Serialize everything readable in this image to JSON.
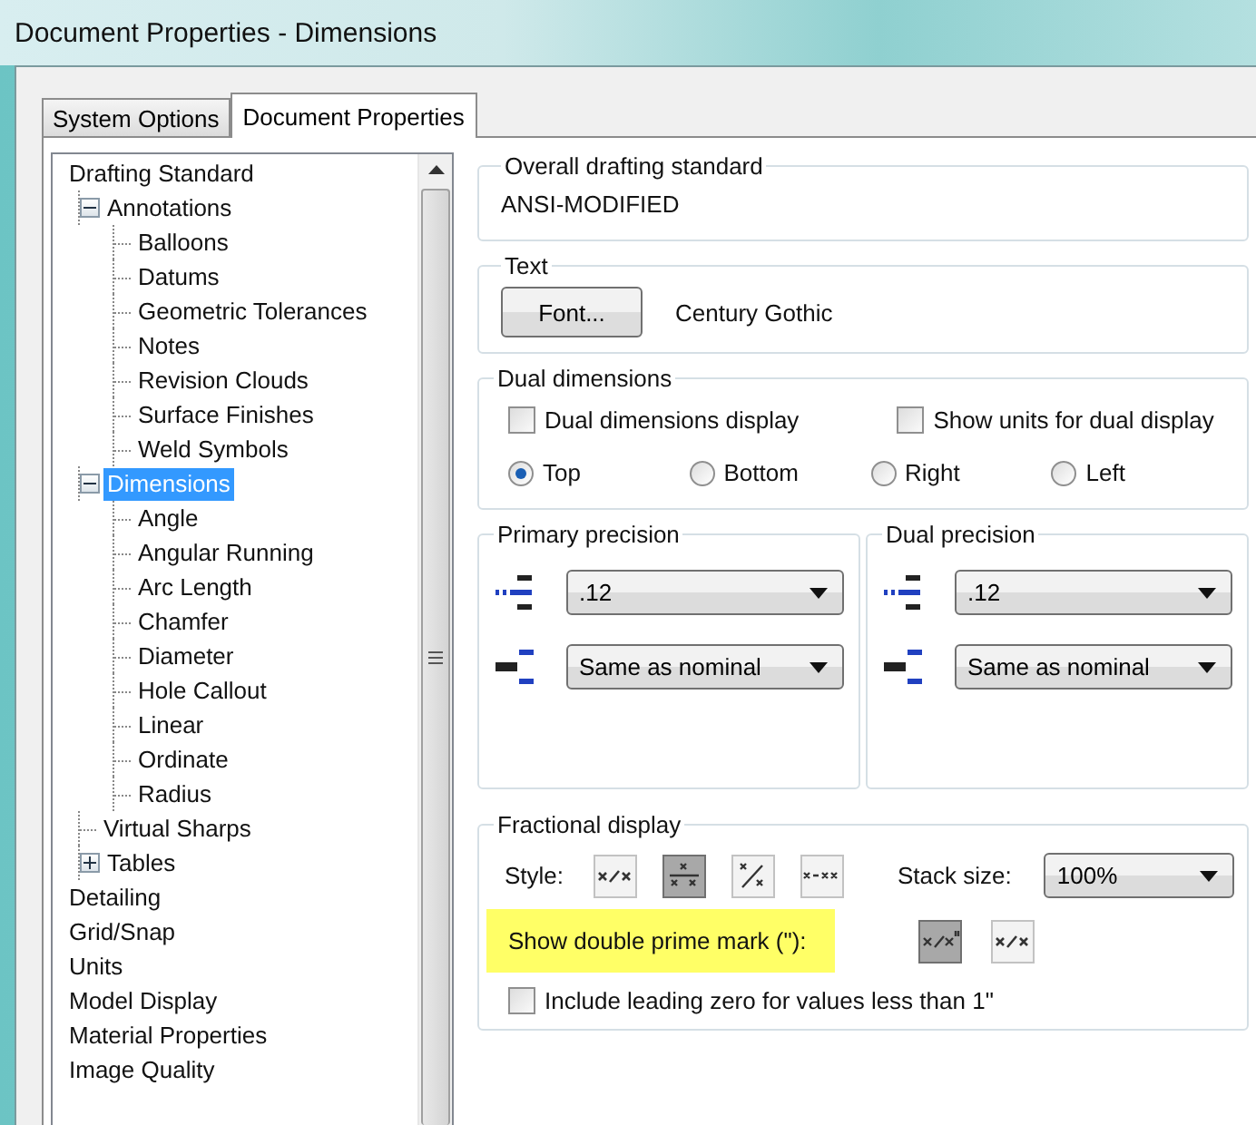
{
  "window": {
    "title": "Document Properties - Dimensions"
  },
  "tabs": [
    {
      "label": "System Options",
      "selected": false
    },
    {
      "label": "Document Properties",
      "selected": true
    }
  ],
  "tree": {
    "items": [
      {
        "label": "Drafting Standard",
        "selected": false,
        "children": [
          {
            "label": "Annotations",
            "selected": false,
            "expanded": true,
            "children": [
              {
                "label": "Balloons",
                "selected": false
              },
              {
                "label": "Datums",
                "selected": false
              },
              {
                "label": "Geometric Tolerances",
                "selected": false
              },
              {
                "label": "Notes",
                "selected": false
              },
              {
                "label": "Revision Clouds",
                "selected": false
              },
              {
                "label": "Surface Finishes",
                "selected": false
              },
              {
                "label": "Weld Symbols",
                "selected": false
              }
            ]
          },
          {
            "label": "Dimensions",
            "selected": true,
            "expanded": true,
            "children": [
              {
                "label": "Angle",
                "selected": false
              },
              {
                "label": "Angular Running",
                "selected": false
              },
              {
                "label": "Arc Length",
                "selected": false
              },
              {
                "label": "Chamfer",
                "selected": false
              },
              {
                "label": "Diameter",
                "selected": false
              },
              {
                "label": "Hole Callout",
                "selected": false
              },
              {
                "label": "Linear",
                "selected": false
              },
              {
                "label": "Ordinate",
                "selected": false
              },
              {
                "label": "Radius",
                "selected": false
              }
            ]
          },
          {
            "label": "Virtual Sharps",
            "selected": false
          },
          {
            "label": "Tables",
            "selected": false,
            "expanded": false
          }
        ]
      },
      {
        "label": "Detailing",
        "selected": false
      },
      {
        "label": "Grid/Snap",
        "selected": false
      },
      {
        "label": "Units",
        "selected": false
      },
      {
        "label": "Model Display",
        "selected": false
      },
      {
        "label": "Material Properties",
        "selected": false
      },
      {
        "label": "Image Quality",
        "selected": false
      }
    ]
  },
  "drafting_standard": {
    "label": "Overall drafting standard",
    "value": "ANSI-MODIFIED"
  },
  "text": {
    "label": "Text",
    "font_button": "Font...",
    "font_name": "Century Gothic"
  },
  "dual_dimensions": {
    "label": "Dual dimensions",
    "checkboxes": [
      {
        "label": "Dual dimensions display",
        "checked": false
      },
      {
        "label": "Show units for dual display",
        "checked": false
      }
    ],
    "radios": [
      {
        "label": "Top",
        "selected": true
      },
      {
        "label": "Bottom",
        "selected": false
      },
      {
        "label": "Right",
        "selected": false
      },
      {
        "label": "Left",
        "selected": false
      }
    ]
  },
  "precision_groups": [
    {
      "label": "Primary precision",
      "value": ".12",
      "tolerance": "Same as nominal"
    },
    {
      "label": "Dual precision",
      "value": ".12",
      "tolerance": "Same as nominal"
    }
  ],
  "fractional_display": {
    "label": "Fractional display",
    "style_label": "Style:",
    "styles": [
      {
        "kind": "inline",
        "selected": false
      },
      {
        "kind": "stacked",
        "selected": true
      },
      {
        "kind": "diagonal",
        "selected": false
      },
      {
        "kind": "dash",
        "selected": false
      }
    ],
    "stack_size_label": "Stack size:",
    "stack_size": "100%",
    "double_prime_label": "Show double prime mark (\"):",
    "highlighted": true,
    "double_prime_options": [
      {
        "kind": "prime",
        "selected": true
      },
      {
        "kind": "inline",
        "selected": false
      }
    ],
    "leading_zero": {
      "label": "Include leading zero for values less than 1\"",
      "checked": false
    }
  }
}
